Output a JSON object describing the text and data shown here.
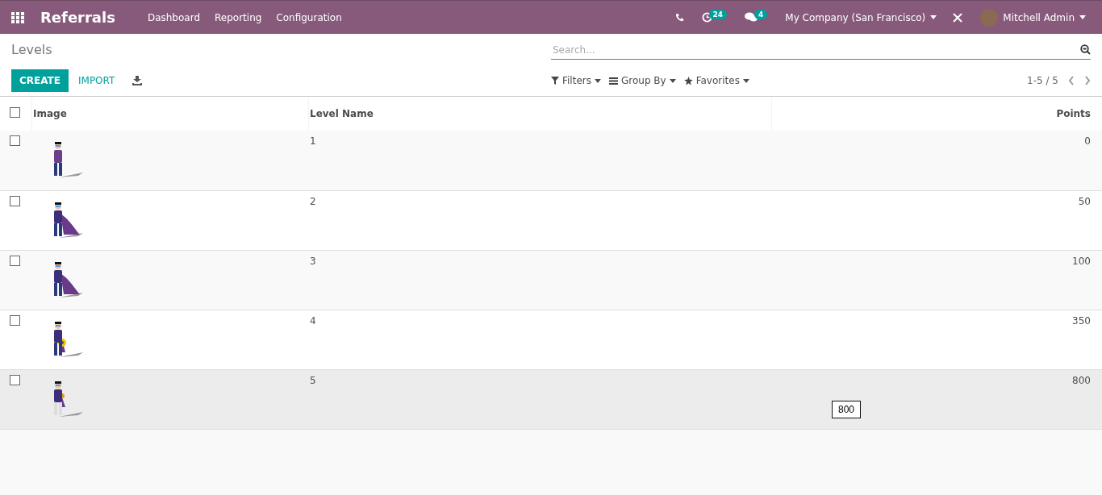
{
  "navbar": {
    "app_name": "Referrals",
    "menu": [
      "Dashboard",
      "Reporting",
      "Configuration"
    ],
    "activity_count": "24",
    "message_count": "4",
    "company": "My Company (San Francisco)",
    "user": "Mitchell Admin"
  },
  "control_panel": {
    "title": "Levels",
    "search": {
      "placeholder": "Search..."
    },
    "buttons": [
      "CREATE",
      "IMPORT"
    ],
    "filters": [
      "Filters",
      "Group By",
      "Favorites"
    ],
    "pager": "1-5 / 5"
  },
  "table": {
    "columns": [
      "Image",
      "Level Name",
      "Points"
    ],
    "header_checked": false,
    "rows": [
      {
        "checked": false,
        "highlighted": false,
        "kind": "plain",
        "level_name": "1",
        "points": "0"
      },
      {
        "checked": false,
        "highlighted": false,
        "kind": "cape",
        "level_name": "2",
        "points": "50"
      },
      {
        "checked": false,
        "highlighted": false,
        "kind": "cape",
        "level_name": "3",
        "points": "100"
      },
      {
        "checked": false,
        "highlighted": false,
        "kind": "shield",
        "level_name": "4",
        "points": "350"
      },
      {
        "checked": false,
        "highlighted": true,
        "kind": "armored",
        "level_name": "5",
        "points": "800",
        "tooltip": "800"
      }
    ]
  }
}
